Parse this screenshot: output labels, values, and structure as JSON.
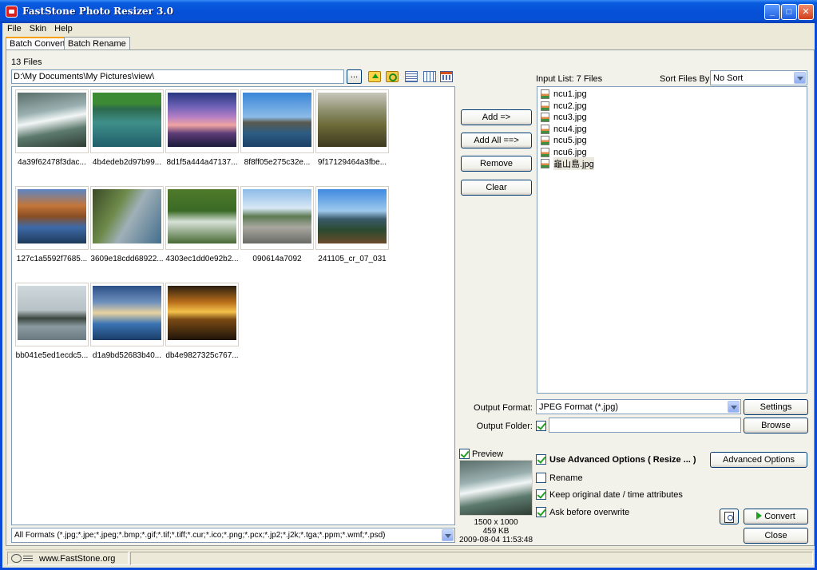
{
  "window": {
    "title": "FastStone Photo Resizer 3.0"
  },
  "menu": [
    "File",
    "Skin",
    "Help"
  ],
  "tabs": [
    "Batch Convert",
    "Batch Rename"
  ],
  "left": {
    "files_count": "13 Files",
    "path": "D:\\My Documents\\My Pictures\\view\\",
    "browse_label": "...",
    "thumbnails": [
      "4a39f62478f3dac...",
      "4b4edeb2d97b99...",
      "8d1f5a444a47137...",
      "8f8ff05e275c32e...",
      "9f17129464a3fbe...",
      "127c1a5592f7685...",
      "3609e18cdd68922...",
      "4303ec1dd0e92b2...",
      "090614a7092",
      "241105_cr_07_031",
      "bb041e5ed1ecdc5...",
      "d1a9bd52683b40...",
      "db4e9827325c767..."
    ],
    "format_filter": "All Formats (*.jpg;*.jpe;*.jpeg;*.bmp;*.gif;*.tif;*.tiff;*.cur;*.ico;*.png;*.pcx;*.jp2;*.j2k;*.tga;*.ppm;*.wmf;*.psd)"
  },
  "middle": {
    "add": "Add =>",
    "add_all": "Add All ==>",
    "remove": "Remove",
    "clear": "Clear"
  },
  "right": {
    "input_list_label": "Input List:  7 Files",
    "sort_label": "Sort Files By:",
    "sort_value": "No Sort",
    "input_list": [
      "ncu1.jpg",
      "ncu2.jpg",
      "ncu3.jpg",
      "ncu4.jpg",
      "ncu5.jpg",
      "ncu6.jpg",
      "龜山島.jpg"
    ],
    "output_format_label": "Output Format:",
    "output_format_value": "JPEG Format (*.jpg)",
    "settings": "Settings",
    "output_folder_label": "Output Folder:",
    "output_folder_value": "",
    "browse": "Browse",
    "options": {
      "use_advanced": "Use Advanced Options ( Resize ... )",
      "advanced_button": "Advanced Options",
      "rename": "Rename",
      "keep_date": "Keep original date / time attributes",
      "ask_overwrite": "Ask before overwrite"
    },
    "convert": "Convert",
    "close": "Close"
  },
  "preview": {
    "label": "Preview",
    "dimensions": "1500 x 1000",
    "size": "459 KB",
    "date": "2009-08-04 11:53:48"
  },
  "status": {
    "url": "www.FastStone.org"
  }
}
